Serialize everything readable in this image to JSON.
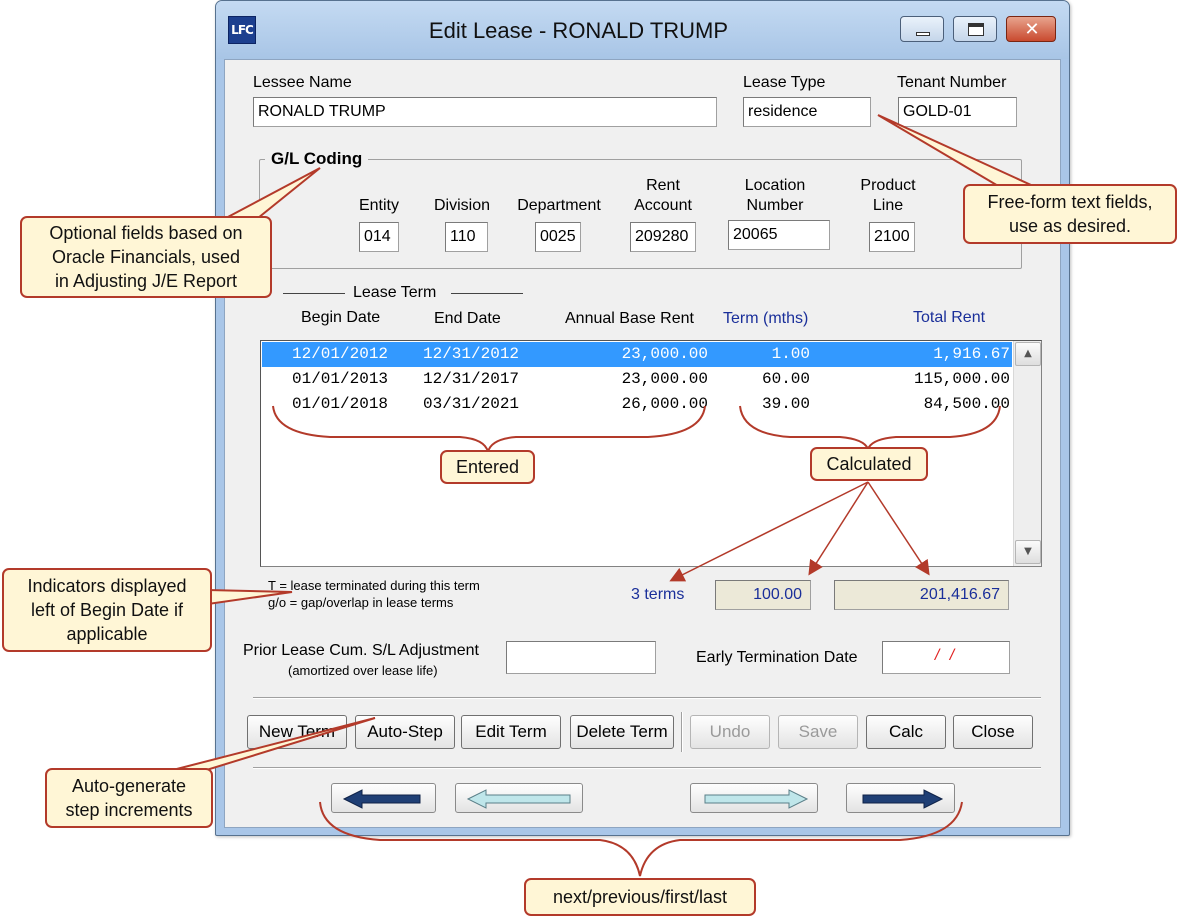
{
  "window": {
    "title": "Edit Lease - RONALD TRUMP",
    "app_icon_text": "LFC",
    "controls": [
      "minimize",
      "maximize",
      "close"
    ]
  },
  "lessee": {
    "name_label": "Lessee Name",
    "name_value": "RONALD TRUMP",
    "type_label": "Lease Type",
    "type_value": "residence",
    "tenant_label": "Tenant  Number",
    "tenant_value": "GOLD-01"
  },
  "gl": {
    "title": "G/L Coding",
    "entity_label": "Entity",
    "entity_value": "014",
    "division_label": "Division",
    "division_value": "110",
    "department_label": "Department",
    "department_value": "0025",
    "rent_account_label_1": "Rent",
    "rent_account_label_2": "Account",
    "rent_account_value": "209280",
    "location_label_1": "Location",
    "location_label_2": "Number",
    "location_value": "20065",
    "product_label_1": "Product",
    "product_label_2": "Line",
    "product_value": "2100"
  },
  "lease_term": {
    "title": "Lease Term",
    "columns": [
      "Begin Date",
      "End Date",
      "Annual Base Rent",
      "Term (mths)",
      "Total Rent"
    ],
    "rows": [
      {
        "begin": "12/01/2012",
        "end": "12/31/2012",
        "annual": "23,000.00",
        "term": "1.00",
        "total": "1,916.67",
        "selected": true
      },
      {
        "begin": "01/01/2013",
        "end": "12/31/2017",
        "annual": "23,000.00",
        "term": "60.00",
        "total": "115,000.00",
        "selected": false
      },
      {
        "begin": "01/01/2018",
        "end": "03/31/2021",
        "annual": "26,000.00",
        "term": "39.00",
        "total": "84,500.00",
        "selected": false
      }
    ],
    "legend_1": "T = lease terminated during this term",
    "legend_2": "g/o = gap/overlap in lease terms",
    "terms_count": "3 terms",
    "term_total": "100.00",
    "rent_total": "201,416.67"
  },
  "prior": {
    "label": "Prior Lease Cum. S/L Adjustment",
    "sublabel": "(amortized over lease life)",
    "value": ""
  },
  "early_termination": {
    "label": "Early Termination Date",
    "value": " / /"
  },
  "buttons": {
    "new_term": "New Term",
    "auto_step": "Auto-Step",
    "edit_term": "Edit Term",
    "delete_term": "Delete Term",
    "undo": "Undo",
    "save": "Save",
    "calc": "Calc",
    "close": "Close"
  },
  "annotations": {
    "optional_fields": [
      "Optional fields based on",
      "Oracle Financials, used",
      "in Adjusting J/E Report"
    ],
    "free_form": [
      "Free-form text fields,",
      "use as desired."
    ],
    "entered": "Entered",
    "calculated": "Calculated",
    "indicators": [
      "Indicators displayed",
      "left of Begin Date if",
      "applicable"
    ],
    "auto_generate": [
      "Auto-generate",
      "step increments"
    ],
    "nav": "next/previous/first/last"
  },
  "colors": {
    "title_bar": "#a9c6e8",
    "selection": "#3399ff",
    "calculated_text": "#1a2f9a",
    "callout_fill": "#fff6d6",
    "callout_border": "#b33a2a",
    "early_termination_text": "#e02020"
  }
}
